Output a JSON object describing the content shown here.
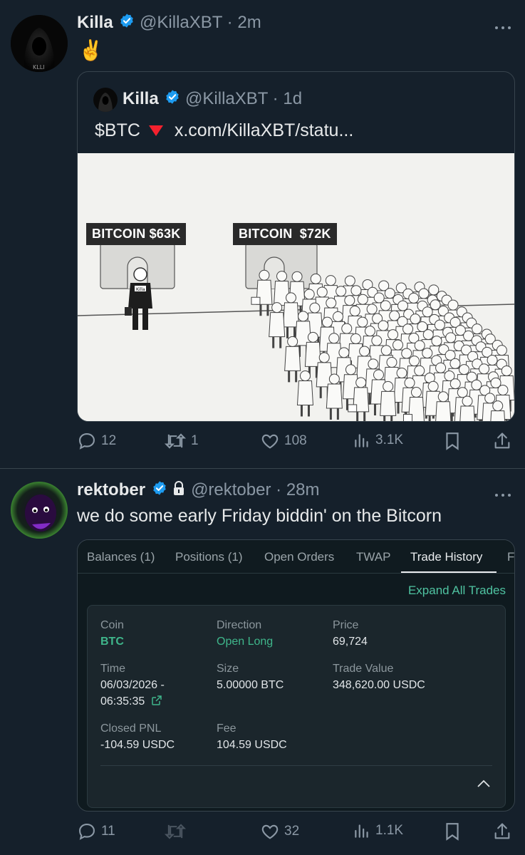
{
  "tweet1": {
    "author_name": "Killa",
    "handle": "@KillaXBT",
    "separator": "·",
    "time": "2m",
    "text": "✌️",
    "quote": {
      "author_name": "Killa",
      "handle": "@KillaXBT",
      "separator": "·",
      "time": "1d",
      "text_prefix": "$BTC",
      "text_link": "x.com/KillaXBT/statu...",
      "image": {
        "left_sign": "BITCOIN $63K",
        "right_sign": "BITCOIN  $72K",
        "badge": "Killa"
      }
    },
    "stats": {
      "replies": "12",
      "reposts": "1",
      "likes": "108",
      "views": "3.1K"
    }
  },
  "tweet2": {
    "author_name": "rektober",
    "handle": "@rektober",
    "separator": "·",
    "time": "28m",
    "text": "we do some early Friday biddin' on the Bitcorn",
    "trade": {
      "tabs": [
        "Balances (1)",
        "Positions (1)",
        "Open Orders",
        "TWAP",
        "Trade History",
        "F"
      ],
      "active_tab": "Trade History",
      "expand_label": "Expand All Trades",
      "coin_label": "Coin",
      "coin_value": "BTC",
      "direction_label": "Direction",
      "direction_value": "Open Long",
      "price_label": "Price",
      "price_value": "69,724",
      "time_label": "Time",
      "time_value_line1": "06/03/2026 -",
      "time_value_line2": "06:35:35",
      "size_label": "Size",
      "size_value": "5.00000 BTC",
      "trade_value_label": "Trade Value",
      "trade_value_value": "348,620.00 USDC",
      "closed_pnl_label": "Closed PNL",
      "closed_pnl_value": "-104.59 USDC",
      "fee_label": "Fee",
      "fee_value": "104.59 USDC"
    },
    "stats": {
      "replies": "11",
      "reposts": "",
      "likes": "32",
      "views": "1.1K"
    }
  },
  "colors": {
    "background": "#15202b",
    "verified": "#1d9bf0",
    "down_arrow": "#f4212e",
    "trade_green": "#3fb68b"
  },
  "icons": [
    "verified-badge-icon",
    "lock-icon",
    "more-icon",
    "reply-icon",
    "repost-icon",
    "like-icon",
    "views-icon",
    "bookmark-icon",
    "share-icon",
    "external-link-icon",
    "chevron-up-icon",
    "down-triangle-icon"
  ]
}
